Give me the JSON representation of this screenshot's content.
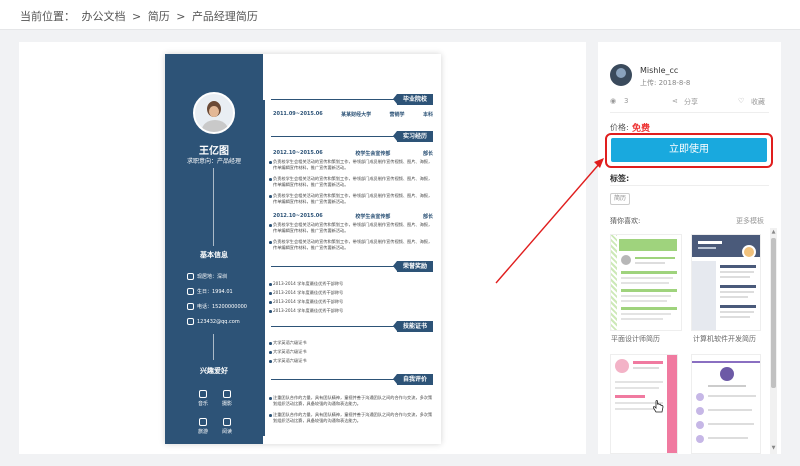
{
  "breadcrumb": {
    "prefix": "当前位置：",
    "items": [
      "办公文档",
      "简历",
      "产品经理简历"
    ],
    "sep": ">"
  },
  "resume": {
    "name": "王亿图",
    "intent": "求职意向：产品经理",
    "basic_title": "基本信息",
    "contacts": [
      "现居地：深圳",
      "生日：1994.01",
      "电话：15200000000",
      "123432@qq.com"
    ],
    "hobby_title": "兴趣爱好",
    "hobbies": [
      "音乐",
      "摄影",
      "旅游",
      "阅读"
    ],
    "sections": {
      "education": "毕业院校",
      "experience": "实习经历",
      "awards": "荣誉奖励",
      "skills": "技能证书",
      "self": "自我评价"
    },
    "edu": {
      "date": "2011.09~2015.06",
      "school": "某某财经大学",
      "major": "营销学",
      "degree": "本科"
    },
    "jobs": [
      {
        "date": "2012.10~2015.06",
        "title": "校学生会宣传部",
        "role": "部长",
        "bullets": [
          "负责校学生会相关活动的宣传和策划工作，带领部门成员制作宣传视频、图片、海报，传单编辑宣传材料，推广宣传要新活动。",
          "负责校学生会相关活动的宣传和策划工作，带领部门成员制作宣传视频、图片、海报，传单编辑宣传材料，推广宣传要新活动。",
          "负责校学生会相关活动的宣传和策划工作，带领部门成员制作宣传视频、图片、海报，传单编辑宣传材料，推广宣传要新活动。"
        ]
      },
      {
        "date": "2012.10~2015.06",
        "title": "校学生会宣传部",
        "role": "部长",
        "bullets": [
          "负责校学生会相关活动的宣传和策划工作，带领部门成员制作宣传视频、图片、海报，传单编辑宣传材料，推广宣传要新活动。",
          "负责校学生会相关活动的宣传和策划工作，带领部门成员制作宣传视频、图片、海报，传单编辑宣传材料，推广宣传要新活动。"
        ]
      }
    ],
    "awards": [
      "2013-2014 学年度最佳优秀干部称号",
      "2013-2014 学年度最佳优秀干部称号",
      "2013-2014 学年度最佳优秀干部称号",
      "2013-2014 学年度最佳优秀干部称号"
    ],
    "skills": [
      "大学英语六级证书",
      "大学英语六级证书",
      "大学英语六级证书"
    ],
    "self": [
      "注重团队合作的力量，具有团队精神，童视并善于沟通团队之间的合作与交流，多次策划组织活动比赛，具备较强的沟通和表达能力。",
      "注重团队合作的力量，具有团队精神，童视并善于沟通团队之间的合作与交流，多次策划组织活动比赛，具备较强的沟通和表达能力。"
    ]
  },
  "sidebar": {
    "author": "Mishle_cc",
    "upload": "上传: 2018-8-8",
    "stats": {
      "views": "3",
      "share": "分享",
      "favorite": "收藏"
    },
    "price_label": "价格:",
    "price_value": "免费",
    "use_button": "立即使用",
    "tags_label": "标签:",
    "tag": "简历",
    "like_label": "猜你喜欢:",
    "more_link": "更多模板",
    "thumbs": [
      {
        "caption": "平面设计师简历",
        "accent": "#9fd37d"
      },
      {
        "caption": "计算机软件开发简历",
        "accent": "#4a5a7a"
      },
      {
        "caption": "",
        "accent": "#f07aa0"
      },
      {
        "caption": "",
        "accent": "#8a6fc1"
      }
    ]
  },
  "colors": {
    "navy": "#2d5377",
    "button": "#19a9de",
    "price": "#e33333",
    "annotation": "#e01e1e"
  }
}
